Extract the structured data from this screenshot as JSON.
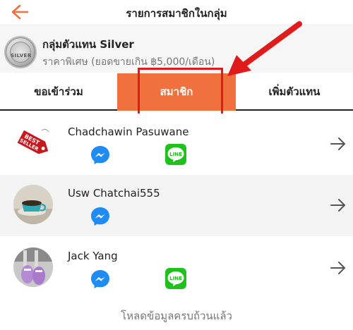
{
  "header": {
    "title": "รายการสมาชิกในกลุ่ม"
  },
  "group": {
    "badge_text": "SILVER",
    "name": "กลุ่มตัวแทน Silver",
    "description": "ราคาพิเศษ (ยอดขายเกิน ฿5,000/เดือน)"
  },
  "tabs": [
    {
      "label": "ขอเข้าร่วม",
      "active": false
    },
    {
      "label": "สมาชิก",
      "active": true
    },
    {
      "label": "เพิ่มตัวแทน",
      "active": false
    }
  ],
  "members": [
    {
      "name": "Chadchawin Pasuwane",
      "has_messenger": true,
      "has_line": true,
      "avatar": "best-seller-tag"
    },
    {
      "name": "Usw Chatchai555",
      "has_messenger": true,
      "has_line": false,
      "avatar": "coffee-cup-photo"
    },
    {
      "name": "Jack Yang",
      "has_messenger": true,
      "has_line": true,
      "avatar": "sandals-photo"
    }
  ],
  "line_label": "LINE",
  "footer": {
    "text": "โหลดข้อมูลครบถ้วนแล้ว"
  },
  "colors": {
    "accent": "#f0703e",
    "annotation": "#e01b1b",
    "messenger": "#1f8cf5",
    "line": "#1fc21a"
  }
}
